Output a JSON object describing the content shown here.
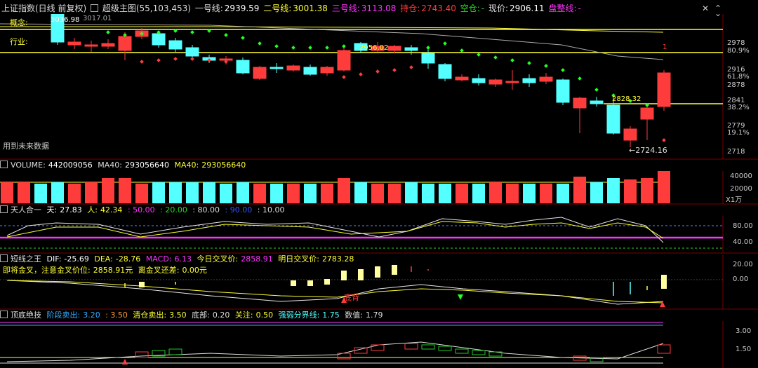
{
  "topbar": {
    "index_name": "上证指数(日线 前复权)",
    "main_chart_label": "超级主图(55,103,453)",
    "line1_label": "一号线:",
    "line1_value": "2939.59",
    "line2_label": "二号线:",
    "line2_value": "3001.38",
    "line3_label": "三号线:",
    "line3_value": "3113.08",
    "hold_label": "持仓:",
    "hold_value": "2743.40",
    "empty_label": "空仓:",
    "empty_value": "-",
    "price_label": "现价:",
    "price_value": "2906.11",
    "consolidate_label": "盘整线:",
    "consolidate_value": "-"
  },
  "main_chart": {
    "tag_concept": "概念:",
    "tag_industry": "行业:",
    "future_data_note": "用到未来数据",
    "top_labels": [
      "3036.98",
      "3017.01"
    ],
    "price_labels": [
      "2978",
      "2916",
      "2878",
      "2841",
      "2779",
      "2718"
    ],
    "pct_labels": [
      "80.9%",
      "61.8%",
      "38.2%",
      "19.1%"
    ],
    "annot_level1": "2956.02",
    "annot_level2": "2828.32",
    "annot_low": "2724.16",
    "annot_one": "1"
  },
  "volume": {
    "title": "VOLUME:",
    "value": "442009056",
    "ma40_label": "MA40:",
    "ma40_value": "293056640",
    "ma40b_label": "MA40:",
    "ma40b_value": "293056640",
    "axis": [
      "40000",
      "20000"
    ],
    "unit": "X1万"
  },
  "tianren": {
    "title": "天人合一",
    "tian_label": "天:",
    "tian_value": "27.83",
    "ren_label": "人:",
    "ren_value": "42.34",
    "l50": ": 50.00",
    "l20": ": 20.00",
    "l80": ": 80.00",
    "l90": ": 90.00",
    "l10": ": 10.00",
    "axis": [
      "80.00",
      "40.00"
    ]
  },
  "macd": {
    "title": "短线之王",
    "dif_label": "DIF:",
    "dif_value": "-25.69",
    "dea_label": "DEA:",
    "dea_value": "-28.76",
    "macd_label": "MACD:",
    "macd_value": "6.13",
    "today_cross_label": "今日交叉价:",
    "today_cross_value": "2858.91",
    "tomorrow_cross_label": "明日交叉价:",
    "tomorrow_cross_value": "2783.28",
    "line2_prefix": "即将金叉，注意金叉价位:",
    "line2_price": "2858.91元",
    "line2_suffix": "离金叉还差:",
    "line2_diff": "0.00元",
    "annot_bottom": "底背",
    "axis": [
      "20.00",
      "0.00"
    ]
  },
  "topbottom": {
    "title": "顶底绝技",
    "sell_label": "阶段卖出:",
    "sell_value1": "3.20",
    "sell_value2": ": 3.50",
    "clear_label": "清仓卖出:",
    "clear_value": "3.50",
    "bottom_label": "底部:",
    "bottom_value": "0.20",
    "watch_label": "关注:",
    "watch_value": "0.50",
    "strength_label": "强弱分界线:",
    "strength_value": "1.75",
    "num_label": "数值:",
    "num_value": "1.79",
    "axis": [
      "3.00",
      "1.50"
    ]
  },
  "colors": {
    "up": "#ff3c3c",
    "down": "#54ffff",
    "yellow": "#ffff33",
    "magenta": "#ff33ff",
    "green": "#22dd22",
    "white": "#e8e8e8"
  }
}
